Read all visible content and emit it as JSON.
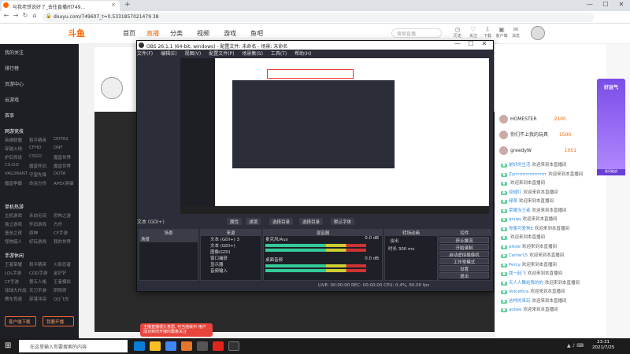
{
  "browser": {
    "tab_title": "与我老铁说好了_去往直播间749...",
    "tab_close": "×",
    "new_tab": "+",
    "url": "douyu.com/749607_t=0.5331857021479 38",
    "controls": [
      "—",
      "☐",
      "✕"
    ],
    "nav": [
      "←",
      "→",
      "↻",
      "⌂"
    ]
  },
  "site": {
    "logo_text": "斗鱼",
    "nav": [
      "首页",
      "直播",
      "分类",
      "视频",
      "游戏",
      "鱼吧"
    ],
    "search_placeholder": "搜索直播",
    "header_icons": [
      {
        "label": "历史",
        "glyph": "◷"
      },
      {
        "label": "关注",
        "glyph": "♡"
      },
      {
        "label": "下载",
        "glyph": "⇩"
      },
      {
        "label": "客户端",
        "glyph": "▣"
      },
      {
        "label": "消息",
        "glyph": "✉"
      }
    ]
  },
  "sidebar": {
    "top_items": [
      "我的关注",
      "排行榜",
      "页游中心",
      "云游戏",
      "赛事"
    ],
    "section_net": "网游竞技",
    "net_games": [
      "英雄联盟",
      "和平精英",
      "DOTA2",
      "穿越火线",
      "CFHD",
      "DNF",
      "炉石传说",
      "CSGO",
      "魔兽世界",
      "CS:GO",
      "魔兽怀旧",
      "魔兽世界",
      "VALORANT",
      "守望先锋",
      "DOTA",
      "魔兽争霸",
      "命运方舟",
      "APEX英雄"
    ],
    "section_mobile": "单机热游",
    "mobile_games": [
      "主机游戏",
      "永劫无间",
      "恐怖之游",
      "独立游戏",
      "怀旧游戏",
      "方舟",
      "堡垒之夜",
      "原神",
      "CF手游",
      "怪物猎人",
      "好玩游戏",
      "我的世界"
    ],
    "section_more": "手游休闲",
    "more_games": [
      "王者荣耀",
      "和平精英",
      "火影忍者",
      "LOL手游",
      "COD手游",
      "金铲铲",
      "CF手游",
      "第五人格",
      "王者模拟",
      "球球大作战",
      "天刀手游",
      "阴阳师",
      "赛车竞速",
      "部落冲突",
      "QQ飞车"
    ],
    "btn_download": "客户端下载",
    "btn_start": "我要开播"
  },
  "obs": {
    "title": "OBS 26.1.1 (64-bit, windows) - 配置文件: 未命名 - 场景: 未命名",
    "menu": [
      "文件(F)",
      "编辑(E)",
      "视图(V)",
      "配置文件(P)",
      "场景集(S)",
      "工具(T)",
      "帮助(H)"
    ],
    "source_label": "文本 (GDI+)",
    "tab_buttons": [
      "属性",
      "滤镜",
      "选择目录",
      "选择目录",
      "默认字体"
    ],
    "scene_header": "场景",
    "scene_items": [
      "场景"
    ],
    "source_header": "来源",
    "source_items": [
      "文本 (GDI+) 3",
      "文本 (GDI+)",
      "图像(GDI)",
      "窗口捕获",
      "显示器",
      "音频输入"
    ],
    "mixer_header": "混音器",
    "mixer_tracks": [
      {
        "name": "桌面音频",
        "db": "0.0 dB"
      },
      {
        "name": "麦克风/Aux",
        "db": "0.0 dB"
      }
    ],
    "transition_header": "转场动画",
    "transition_type": "淡出",
    "transition_duration_label": "时长",
    "transition_duration": "300 ms",
    "controls_header": "控件",
    "controls": [
      "停止推流",
      "开始录制",
      "启动虚拟摄像机",
      "工作室模式",
      "设置",
      "退出"
    ],
    "status": "LIVE: 00:00:00    REC: 00:00:00    CPU: 0.4%, 60.00 fps"
  },
  "chat": {
    "ranks": [
      {
        "name": "HOMESTER",
        "score": "2100"
      },
      {
        "name": "你们不上我的玩具",
        "score": "1500"
      },
      {
        "name": "greedyW",
        "score": "1051"
      }
    ],
    "messages": [
      {
        "user": "是好的生活",
        "text": "欢迎来到本直播间"
      },
      {
        "user": "Zyrrrrrrrrrrrrrrrrrrr",
        "text": "欢迎来到本直播间"
      },
      {
        "user": "",
        "text": "欢迎来到本直播间"
      },
      {
        "user": "双缝叮",
        "text": "欢迎来到本直播间"
      },
      {
        "user": "绿茶",
        "text": "欢迎来到本直播间"
      },
      {
        "user": "荣耀当王者",
        "text": "欢迎来到本直播间"
      },
      {
        "user": "qiuqq",
        "text": "欢迎来到本直播间"
      },
      {
        "user": "你像可爱狗E",
        "text": "欢迎来到本直播间"
      },
      {
        "user": "",
        "text": "欢迎来到本直播间"
      },
      {
        "user": "pikde",
        "text": "欢迎来到本直播间"
      },
      {
        "user": "Carter15",
        "text": "欢迎来到本直播间"
      },
      {
        "user": "Percy",
        "text": "欢迎来到本直播间"
      },
      {
        "user": "我一起飞",
        "text": "欢迎来到本直播间"
      },
      {
        "user": "天人人舞给我的的",
        "text": "欢迎来到本直播间"
      },
      {
        "user": "VoiceKira",
        "text": "欢迎来到本直播间"
      },
      {
        "user": "这样的来玩",
        "text": "欢迎来到本直播间"
      },
      {
        "user": "aoliee",
        "text": "欢迎来到本直播间"
      }
    ]
  },
  "promo": {
    "title": "好运气",
    "sub": "乘风破浪"
  },
  "toast": {
    "text": "主播直播很久意思, 可当他就中 用户成功到你开播时跟着关注"
  },
  "taskbar": {
    "search_placeholder": "在这里输入你要搜索的内容",
    "time": "23:31",
    "date": "2021/7/25"
  },
  "colors": {
    "brand": "#ff6600",
    "obs_bg": "#2b2e38",
    "sidebar_bg": "#1e1f25"
  }
}
